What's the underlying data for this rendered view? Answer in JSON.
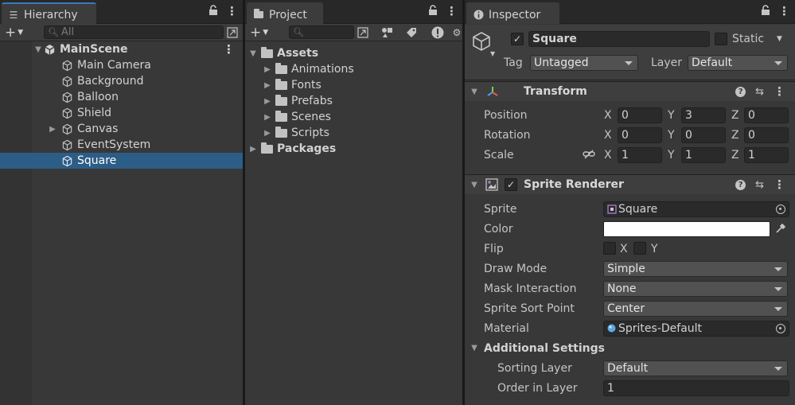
{
  "hierarchy": {
    "tab_label": "Hierarchy",
    "search_placeholder": "All",
    "scene_name": "MainScene",
    "items": [
      {
        "label": "Main Camera"
      },
      {
        "label": "Background"
      },
      {
        "label": "Balloon"
      },
      {
        "label": "Shield"
      },
      {
        "label": "Canvas"
      },
      {
        "label": "EventSystem"
      },
      {
        "label": "Square"
      }
    ],
    "selected": "Square"
  },
  "project": {
    "tab_label": "Project",
    "search_placeholder": "",
    "assets_label": "Assets",
    "folders": [
      {
        "label": "Animations"
      },
      {
        "label": "Fonts"
      },
      {
        "label": "Prefabs"
      },
      {
        "label": "Scenes"
      },
      {
        "label": "Scripts"
      }
    ],
    "packages_label": "Packages"
  },
  "inspector": {
    "tab_label": "Inspector",
    "object_name": "Square",
    "static_label": "Static",
    "tag_label": "Tag",
    "tag_value": "Untagged",
    "layer_label": "Layer",
    "layer_value": "Default",
    "transform": {
      "title": "Transform",
      "position_label": "Position",
      "rotation_label": "Rotation",
      "scale_label": "Scale",
      "x_label": "X",
      "y_label": "Y",
      "z_label": "Z",
      "position": {
        "x": "0",
        "y": "3",
        "z": "0"
      },
      "rotation": {
        "x": "0",
        "y": "0",
        "z": "0"
      },
      "scale": {
        "x": "1",
        "y": "1",
        "z": "1"
      }
    },
    "sprite_renderer": {
      "title": "Sprite Renderer",
      "sprite_label": "Sprite",
      "sprite_value": "Square",
      "color_label": "Color",
      "color_value": "#ffffff",
      "flip_label": "Flip",
      "flip_x": "X",
      "flip_y": "Y",
      "draw_mode_label": "Draw Mode",
      "draw_mode_value": "Simple",
      "mask_label": "Mask Interaction",
      "mask_value": "None",
      "sort_point_label": "Sprite Sort Point",
      "sort_point_value": "Center",
      "material_label": "Material",
      "material_value": "Sprites-Default",
      "additional_label": "Additional Settings",
      "sorting_layer_label": "Sorting Layer",
      "sorting_layer_value": "Default",
      "order_label": "Order in Layer",
      "order_value": "1"
    }
  },
  "colors": {
    "selection": "#2c5d87",
    "active_tab_accent": "#3a79bb",
    "panel_bg": "#383838"
  }
}
